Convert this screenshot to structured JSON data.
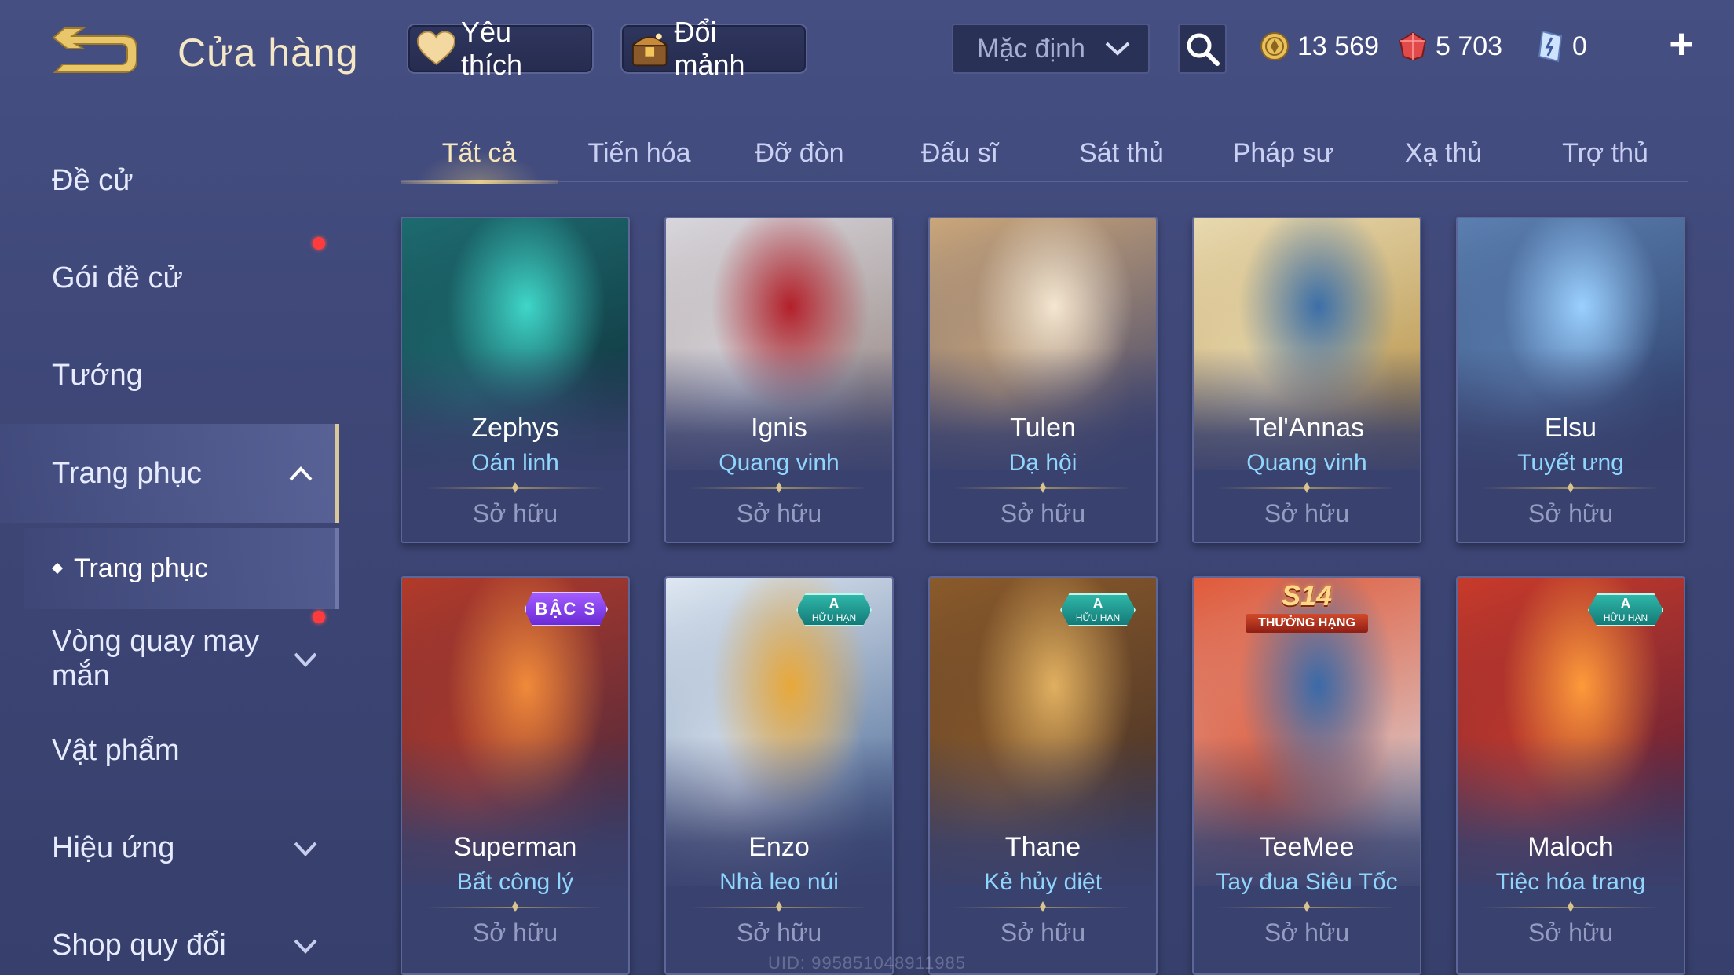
{
  "header": {
    "title": "Cửa hàng",
    "favorites_label": "Yêu thích",
    "shard_exchange_label": "Đổi mảnh",
    "sort_selected": "Mặc định",
    "currency": {
      "gold": "13 569",
      "ruby": "5 703",
      "voucher": "0"
    }
  },
  "sidebar": {
    "items": [
      {
        "label": "Đề cử"
      },
      {
        "label": "Gói đề cử"
      },
      {
        "label": "Tướng"
      },
      {
        "label": "Trang phục"
      },
      {
        "label": "Trang phục"
      },
      {
        "label": "Vòng quay may mắn"
      },
      {
        "label": "Vật phẩm"
      },
      {
        "label": "Hiệu ứng"
      },
      {
        "label": "Shop quy đổi"
      }
    ]
  },
  "tabs": [
    {
      "label": "Tất cả"
    },
    {
      "label": "Tiến hóa"
    },
    {
      "label": "Đỡ đòn"
    },
    {
      "label": "Đấu sĩ"
    },
    {
      "label": "Sát thủ"
    },
    {
      "label": "Pháp sư"
    },
    {
      "label": "Xạ thủ"
    },
    {
      "label": "Trợ thủ"
    }
  ],
  "cards": [
    {
      "hero": "Zephys",
      "skin": "Oán linh",
      "status": "Sở hữu",
      "colors": [
        "#1d6b6f",
        "#0e2b36",
        "#3fd6c8"
      ]
    },
    {
      "hero": "Ignis",
      "skin": "Quang vinh",
      "status": "Sở hữu",
      "colors": [
        "#d8d6dc",
        "#8f7e78",
        "#b3202a"
      ]
    },
    {
      "hero": "Tulen",
      "skin": "Dạ hội",
      "status": "Sở hữu",
      "colors": [
        "#caa67a",
        "#3a3f6a",
        "#f4e6d0"
      ]
    },
    {
      "hero": "Tel'Annas",
      "skin": "Quang vinh",
      "status": "Sở hữu",
      "colors": [
        "#e8d9b0",
        "#b08a3c",
        "#3c6fa8"
      ]
    },
    {
      "hero": "Elsu",
      "skin": "Tuyết ưng",
      "status": "Sở hữu",
      "colors": [
        "#5a7fb0",
        "#2a3a66",
        "#9ad0ff"
      ]
    },
    {
      "hero": "Superman",
      "skin": "Bất công lý",
      "status": "Sở hữu",
      "badge_text": "BẬC S",
      "colors": [
        "#b23a2a",
        "#3a2540",
        "#f08a3a"
      ]
    },
    {
      "hero": "Enzo",
      "skin": "Nhà leo núi",
      "status": "Sở hữu",
      "badge_text": "A",
      "badge_sub": "HỮU HẠN",
      "colors": [
        "#dfe8f2",
        "#3a5a8a",
        "#e8a83a"
      ]
    },
    {
      "hero": "Thane",
      "skin": "Kẻ hủy diệt",
      "status": "Sở hữu",
      "badge_text": "A",
      "badge_sub": "HỮU HẠN",
      "colors": [
        "#8a5a2a",
        "#3a2a28",
        "#e0b060"
      ]
    },
    {
      "hero": "TeeMee",
      "skin": "Tay đua Siêu Tốc",
      "status": "Sở hữu",
      "badge_text": "S14",
      "badge_sub": "THƯỞNG HẠNG",
      "colors": [
        "#e05a3a",
        "#d8e4ee",
        "#3a6aa8"
      ]
    },
    {
      "hero": "Maloch",
      "skin": "Tiệc hóa trang",
      "status": "Sở hữu",
      "badge_text": "A",
      "badge_sub": "HỮU HẠN",
      "colors": [
        "#c83a2a",
        "#4a1a3a",
        "#ff9a3a"
      ]
    }
  ],
  "footer": {
    "uid": "UID: 995851048911985"
  }
}
